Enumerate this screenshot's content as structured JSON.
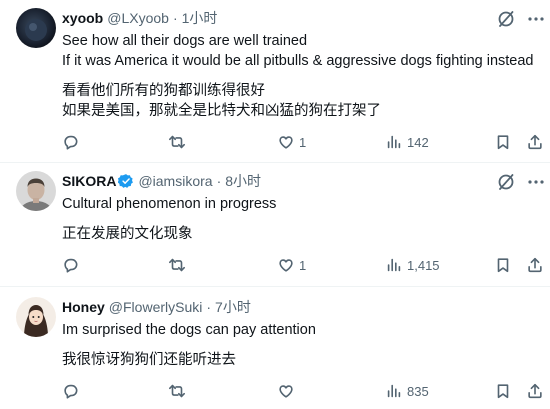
{
  "replies": [
    {
      "name": "xyoob",
      "handle": "@LXyoob",
      "dot": "·",
      "time": "1小时",
      "lines": [
        "See how all their dogs are well trained",
        "If it was America it would be all pitbulls & aggressive dogs fighting instead",
        "",
        "看看他们所有的狗都训练得很好",
        "如果是美国，那就全是比特犬和凶猛的狗在打架了"
      ],
      "stats": {
        "replies": "",
        "reposts": "",
        "likes": "1",
        "views": "142"
      }
    },
    {
      "name": "SIKORA",
      "verified": true,
      "handle": "@iamsikora",
      "dot": "·",
      "time": "8小时",
      "lines": [
        "Cultural phenomenon in progress",
        "",
        "正在发展的文化现象"
      ],
      "stats": {
        "replies": "",
        "reposts": "",
        "likes": "1",
        "views": "1,415"
      }
    },
    {
      "name": "Honey",
      "handle": "@FlowerlySuki",
      "dot": "·",
      "time": "7小时",
      "lines": [
        "Im surprised the dogs can pay attention",
        "",
        "我很惊讶狗狗们还能听进去"
      ],
      "stats": {
        "replies": "",
        "reposts": "",
        "likes": "",
        "views": "835"
      }
    }
  ],
  "icons": {
    "verified_badge": "verified-check-icon",
    "grok": "grok-icon",
    "more": "more-dots-icon",
    "reply": "reply-bubble-icon",
    "repost": "repost-icon",
    "like": "heart-icon",
    "views": "views-bar-chart-icon",
    "bookmark": "bookmark-icon",
    "share": "share-icon"
  },
  "colors": {
    "text": "#0f1419",
    "secondary": "#536471",
    "divider": "#eff3f4",
    "verified": "#1d9bf0"
  }
}
